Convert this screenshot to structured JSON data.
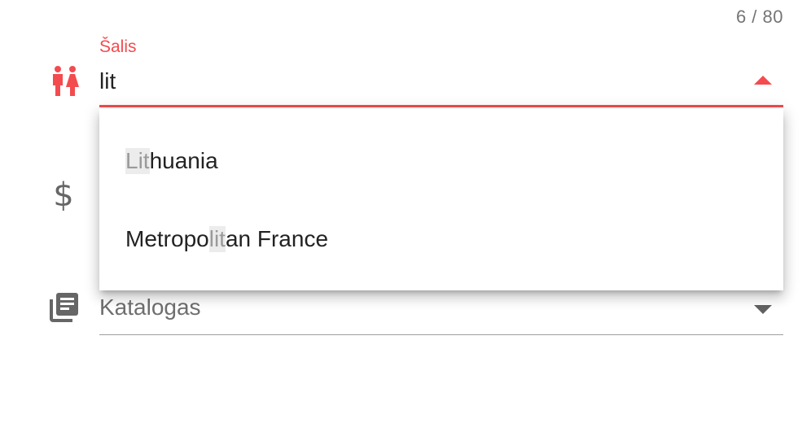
{
  "counter": "6 / 80",
  "country": {
    "label": "Šalis",
    "value": "lit",
    "icon": "people-icon",
    "accent_color": "#f44b4f"
  },
  "dropdown": {
    "options": [
      {
        "before": "",
        "match": "Lit",
        "after": "huania"
      },
      {
        "before": "Metropo",
        "match": "lit",
        "after": "an France"
      }
    ]
  },
  "price": {
    "icon": "dollar-icon",
    "symbol": "$"
  },
  "catalog": {
    "placeholder": "Katalogas",
    "icon": "library-books-icon"
  }
}
